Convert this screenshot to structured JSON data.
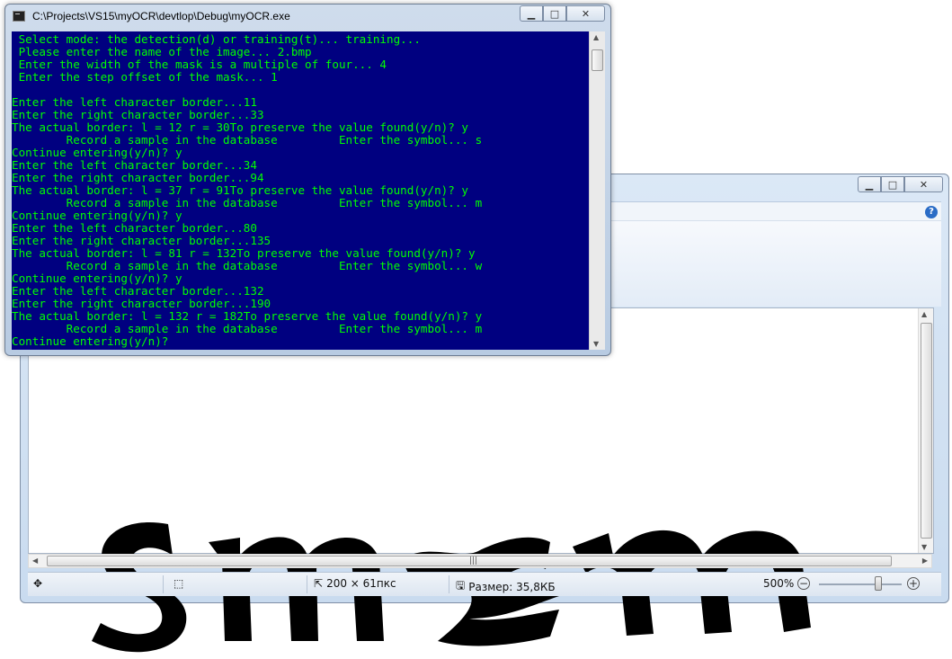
{
  "console": {
    "title": "C:\\Projects\\VS15\\myOCR\\devtlop\\Debug\\myOCR.exe",
    "lines": [
      " Select mode: the detection(d) or training(t)... training...",
      " Please enter the name of the image... 2.bmp",
      " Enter the width of the mask is a multiple of four... 4",
      " Enter the step offset of the mask... 1",
      "",
      "Enter the left character border...11",
      "Enter the right character border...33",
      "The actual border: l = 12 r = 30To preserve the value found(y/n)? y",
      "        Record a sample in the database         Enter the symbol... s",
      "Continue entering(y/n)? y",
      "Enter the left character border...34",
      "Enter the right character border...94",
      "The actual border: l = 37 r = 91To preserve the value found(y/n)? y",
      "        Record a sample in the database         Enter the symbol... m",
      "Continue entering(y/n)? y",
      "Enter the left character border...80",
      "Enter the right character border...135",
      "The actual border: l = 81 r = 132To preserve the value found(y/n)? y",
      "        Record a sample in the database         Enter the symbol... w",
      "Continue entering(y/n)? y",
      "Enter the left character border...132",
      "Enter the right character border...190",
      "The actual border: l = 132 r = 182To preserve the value found(y/n)? y",
      "        Record a sample in the database         Enter the symbol... m",
      "Continue entering(y/n)?"
    ],
    "text_color": "#00ff00",
    "bg_color": "#000080"
  },
  "viewer": {
    "captcha_text": "smwm",
    "status": {
      "dimensions": "200 × 61пкс",
      "size": "Размер: 35,8КБ",
      "zoom": "500%"
    },
    "help_label": "?",
    "zoom_level": 0.6
  },
  "caption": {
    "minimize": "▁",
    "maximize": "□",
    "close": "✕"
  }
}
